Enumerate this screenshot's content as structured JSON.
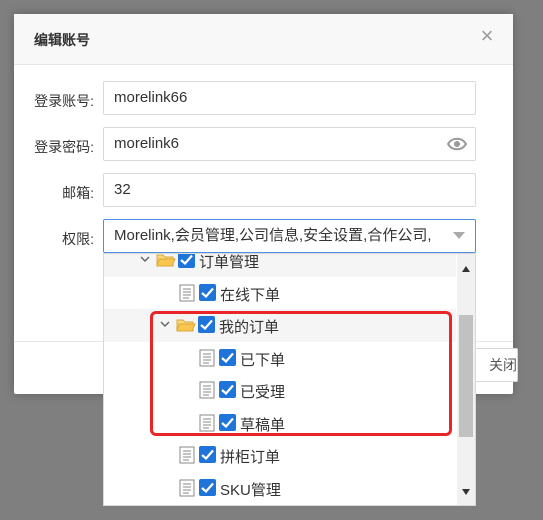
{
  "dialog": {
    "title": "编辑账号",
    "close_label": "×",
    "fields": {
      "account": {
        "label": "登录账号:",
        "value": "morelink66"
      },
      "password": {
        "label": "登录密码:",
        "value": "morelink6"
      },
      "email": {
        "label": "邮箱:",
        "value": "32"
      },
      "permissions": {
        "label": "权限:",
        "value": "Morelink,会员管理,公司信息,安全设置,合作公司,"
      }
    },
    "footer_button": "关闭"
  },
  "tree": {
    "nodes": [
      {
        "label": "订单管理",
        "type": "folder"
      },
      {
        "label": "在线下单",
        "type": "file"
      },
      {
        "label": "我的订单",
        "type": "folder"
      },
      {
        "label": "已下单",
        "type": "file"
      },
      {
        "label": "已受理",
        "type": "file"
      },
      {
        "label": "草稿单",
        "type": "file"
      },
      {
        "label": "拼柜订单",
        "type": "file"
      },
      {
        "label": "SKU管理",
        "type": "file"
      }
    ]
  },
  "icons": [
    "close-icon",
    "eye-icon",
    "chevron-down-icon",
    "folder-open-icon",
    "file-icon",
    "checkbox-checked-icon",
    "scroll-up-icon",
    "scroll-down-icon"
  ],
  "colors": {
    "accent": "#1e74d8",
    "highlight": "#e8262a",
    "focus_border": "#4a90e2"
  }
}
